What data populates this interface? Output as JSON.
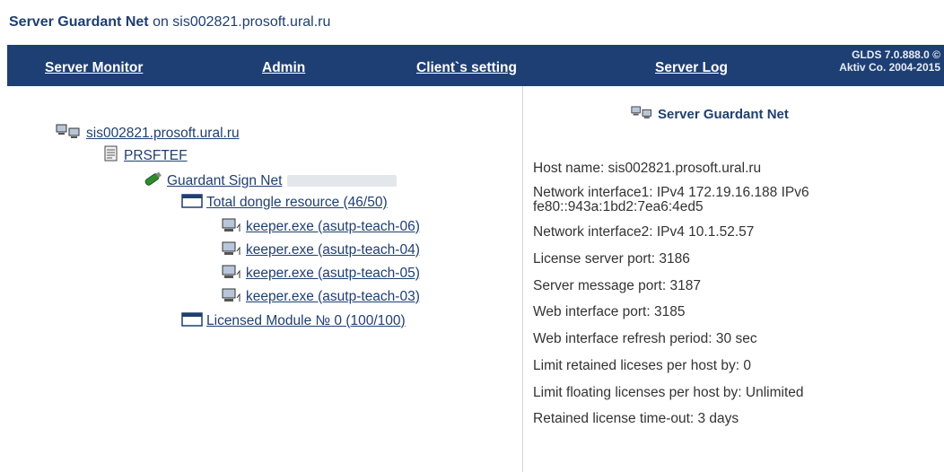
{
  "header": {
    "app_name": "Server Guardant Net",
    "on_host": "on sis002821.prosoft.ural.ru"
  },
  "nav": {
    "server_monitor": "Server Monitor",
    "admin": "Admin",
    "client_setting": "Client`s setting",
    "server_log": "Server Log",
    "version_line1": "GLDS 7.0.888.0 ©",
    "version_line2": "Aktiv Co. 2004-2015"
  },
  "tree": {
    "host": "sis002821.prosoft.ural.ru",
    "org": "PRSFTEF",
    "dongle": "Guardant Sign Net",
    "resource": "Total dongle resource (46/50)",
    "clients": [
      "keeper.exe (asutp-teach-06)",
      "keeper.exe (asutp-teach-04)",
      "keeper.exe (asutp-teach-05)",
      "keeper.exe (asutp-teach-03)"
    ],
    "module": "Licensed Module № 0 (100/100)"
  },
  "info": {
    "title": "Server Guardant Net",
    "host_name": "Host name: sis002821.prosoft.ural.ru",
    "net1_a": "Network interface1: IPv4 172.19.16.188 IPv6",
    "net1_b": "fe80::943a:1bd2:7ea6:4ed5",
    "net2": "Network interface2: IPv4 10.1.52.57",
    "license_port": "License server port: 3186",
    "message_port": "Server message port: 3187",
    "web_port": "Web interface port: 3185",
    "refresh": "Web interface refresh period: 30 sec",
    "limit_retained": "Limit retained liceses per host by: 0",
    "limit_floating": "Limit floating licenses per host by: Unlimited",
    "retained_timeout": "Retained license time-out: 3 days"
  },
  "icons": {
    "host": "network-computers-icon",
    "org": "document-icon",
    "dongle": "usb-dongle-icon",
    "resource": "window-icon",
    "client": "computer-icon",
    "module": "window-icon"
  },
  "colors": {
    "navbar": "#1e3f73",
    "title": "#1f3f70",
    "link": "#1f3f70",
    "dongle_green": "#2e8b2e"
  }
}
